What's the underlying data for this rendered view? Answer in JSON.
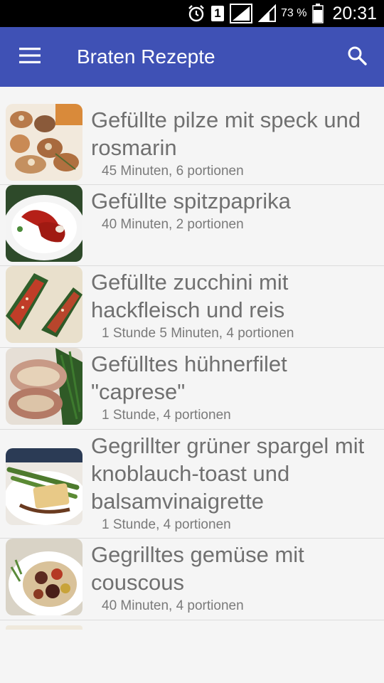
{
  "status_bar": {
    "sim_label": "1",
    "battery_percent": "73 %",
    "time": "20:31",
    "icons": [
      "alarm-icon",
      "sim-icon",
      "signal-icon",
      "signal-icon",
      "battery-icon"
    ]
  },
  "app_bar": {
    "title": "Braten Rezepte",
    "menu_icon": "hamburger-menu-icon",
    "search_icon": "search-icon",
    "color": "#3f51b5"
  },
  "recipes": [
    {
      "title": "Gefüllte pilze mit speck und rosmarin",
      "meta": "45 Minuten, 6 portionen"
    },
    {
      "title": "Gefüllte spitzpaprika",
      "meta": "40 Minuten, 2 portionen"
    },
    {
      "title": "Gefüllte zucchini mit hackfleisch und reis",
      "meta": "1 Stunde 5 Minuten, 4 portionen"
    },
    {
      "title": "Gefülltes hühnerfilet \"caprese\"",
      "meta": "1 Stunde, 4 portionen"
    },
    {
      "title": "Gegrillter grüner spargel mit knoblauch-toast und balsamvinaigrette",
      "meta": "1 Stunde, 4 portionen"
    },
    {
      "title": "Gegrilltes gemüse mit couscous",
      "meta": "40 Minuten, 4 portionen"
    }
  ]
}
